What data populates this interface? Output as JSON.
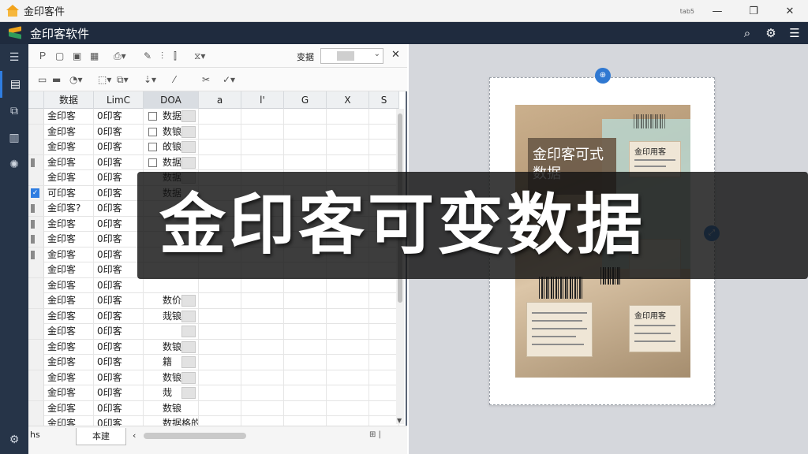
{
  "os_window": {
    "title": "金印客件",
    "mode_label": "tab5",
    "min": "—",
    "max": "❐",
    "close": "✕"
  },
  "app": {
    "title": "金印客软件",
    "search_glyph": "⌕",
    "settings_glyph": "⚙",
    "menu_glyph": "☰"
  },
  "rail": [
    {
      "icon": "list-icon",
      "glyph": "☰"
    },
    {
      "icon": "file-icon",
      "glyph": "▤"
    },
    {
      "icon": "layers-icon",
      "glyph": "⧉"
    },
    {
      "icon": "barcode-icon",
      "glyph": "▥"
    },
    {
      "icon": "settings-icon",
      "glyph": "✺"
    }
  ],
  "rail_bottom": {
    "icon": "settings-icon",
    "glyph": "⚙"
  },
  "toolbar": {
    "field_label": "变据",
    "close": "✕"
  },
  "table": {
    "headers": [
      "数据",
      "LimC",
      "DOA",
      "a",
      "l'",
      "G",
      "X",
      "S"
    ],
    "rows": [
      {
        "c1": "金印客",
        "c2": "0印客",
        "c3": "数据"
      },
      {
        "c1": "金印客",
        "c2": "0印客",
        "c3": "数锒"
      },
      {
        "c1": "金印客",
        "c2": "0印客",
        "c3": "敀锒"
      },
      {
        "c1": "金印客",
        "c2": "0印客",
        "c3": "数据"
      },
      {
        "c1": "金印客",
        "c2": "0印客",
        "c3": "数据"
      },
      {
        "c1": "可印客",
        "c2": "0印客",
        "c3": "数据"
      },
      {
        "c1": "金印客?",
        "c2": "0印客",
        "c3": ""
      },
      {
        "c1": "金印客",
        "c2": "0印客",
        "c3": ""
      },
      {
        "c1": "金印客",
        "c2": "0印客",
        "c3": ""
      },
      {
        "c1": "金印客",
        "c2": "0印客",
        "c3": ""
      },
      {
        "c1": "金印客",
        "c2": "0印客",
        "c3": ""
      },
      {
        "c1": "金印客",
        "c2": "0印客",
        "c3": ""
      },
      {
        "c1": "金印客",
        "c2": "0印客",
        "c3": "数价"
      },
      {
        "c1": "金印客",
        "c2": "0印客",
        "c3": "烖锒"
      },
      {
        "c1": "金印客",
        "c2": "0印客",
        "c3": ""
      },
      {
        "c1": "金印客",
        "c2": "0印客",
        "c3": "数锒"
      },
      {
        "c1": "金印客",
        "c2": "0印客",
        "c3": "籍"
      },
      {
        "c1": "金印客",
        "c2": "0印客",
        "c3": "数锒"
      },
      {
        "c1": "金印客",
        "c2": "0印客",
        "c3": "烖"
      },
      {
        "c1": "金印客",
        "c2": "0印客",
        "c3": "数锒"
      },
      {
        "c1": "金印客",
        "c2": "0印客",
        "c3": "数据格的"
      },
      {
        "c1": "金印客",
        "c2": "0印客",
        "c3": ""
      }
    ]
  },
  "status": {
    "left": "hs",
    "sheet_tab": "本建",
    "nav_left": "‹",
    "end": "⊞ |"
  },
  "preview": {
    "handle_top": "⊕",
    "handle_right": "⤢",
    "poster_heading": "金印客可式数据",
    "card1_title": "金印用客",
    "card2_title": "金印用客"
  },
  "banner": {
    "text": "金印客可变数据"
  }
}
